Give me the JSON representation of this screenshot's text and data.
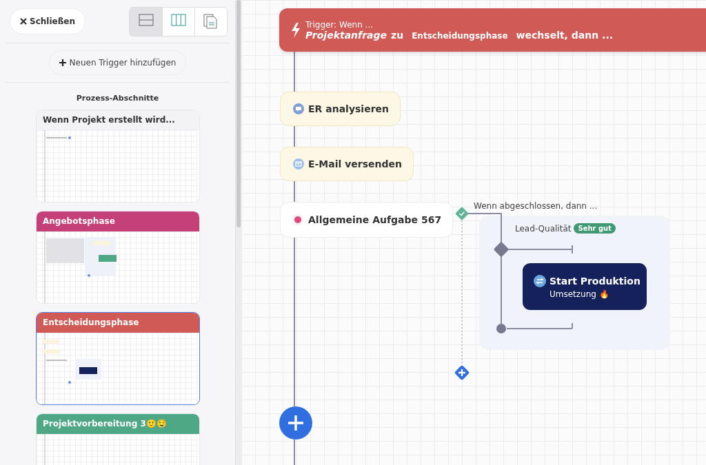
{
  "sidebar": {
    "close_button": "Schließen",
    "view_buttons": [
      {
        "kind": "rows",
        "selected": true
      },
      {
        "kind": "columns",
        "selected": false
      },
      {
        "kind": "document",
        "selected": false
      }
    ],
    "add_trigger_button": "Neuen Trigger hinzufügen",
    "heading": "Prozess-Abschnitte",
    "sections": [
      {
        "title": "Wenn Projekt erstellt wird...",
        "color": "#f3f3f6",
        "selected": false
      },
      {
        "title": "Angebotsphase",
        "color": "#c53f78",
        "selected": false
      },
      {
        "title": "Entscheidungsphase",
        "color": "#d05a55",
        "selected": true
      },
      {
        "title": "Projektvorbereitung 3🙂🤤",
        "color": "#4ea886",
        "selected": false
      }
    ]
  },
  "trigger": {
    "label": "Trigger: Wenn ...",
    "entity": "Projektanfrage",
    "connector": "zu",
    "phase": "Entscheidungsphase",
    "suffix": "wechselt, dann ..."
  },
  "steps": [
    {
      "kind": "chat",
      "title": "ER analysieren"
    },
    {
      "kind": "mail",
      "title": "E-Mail versenden"
    },
    {
      "kind": "task",
      "title": "Allgemeine Aufgabe 567",
      "color": "#e0497a"
    }
  ],
  "branch": {
    "condition": "Wenn abgeschlossen, dann ...",
    "rule": "Lead-Qualität",
    "badge": "Sehr gut",
    "action": {
      "title": "Start Produktion",
      "subtitle": "Umsetzung 🔥"
    }
  }
}
